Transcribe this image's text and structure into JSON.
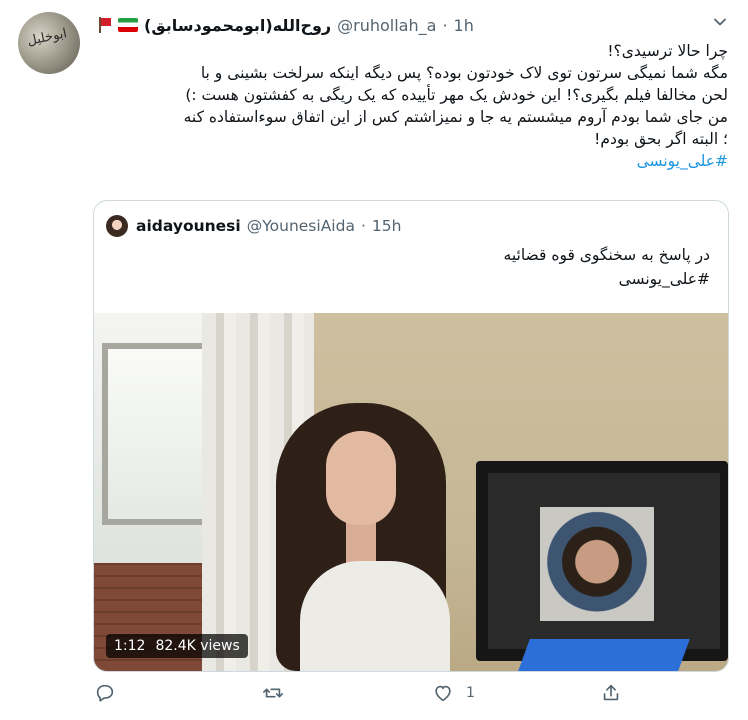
{
  "tweet": {
    "display_name": "روح‌الله(ابومحمودسابق)",
    "handle": "@ruhollah_a",
    "separator": "·",
    "time": "1h",
    "lines": [
      "چرا حالا ترسیدی؟!",
      "مگه شما نمیگی سرتون توی لاک خودتون بوده؟ پس دیگه اینکه سرلخت بشینی و با",
      "لحن مخالفا فیلم بگیری؟! این خودش یک مهر تأییده که یک ریگی به کفشتون هست :)",
      "من جای شما بودم آروم میشستم یه جا و نمیزاشتم کس از این اتفاق سوءاستفاده کنه",
      "؛ البته اگر بحق بودم!"
    ],
    "hashtag": "#علی_یونسی"
  },
  "quote": {
    "display_name": "aidayounesi",
    "handle": "@YounesiAida",
    "separator": "·",
    "time": "15h",
    "lines": [
      "در پاسخ به سخنگوی قوه قضائیه"
    ],
    "hashtag": "#علی_یونسی",
    "video": {
      "duration": "1:12",
      "views": "82.4K views"
    }
  },
  "actions": {
    "like_count": "1",
    "icons": [
      "reply-icon",
      "retweet-icon",
      "like-icon",
      "share-icon"
    ]
  },
  "colors": {
    "link": "#1b95e0",
    "muted": "#536471",
    "border": "#cfd9de"
  }
}
